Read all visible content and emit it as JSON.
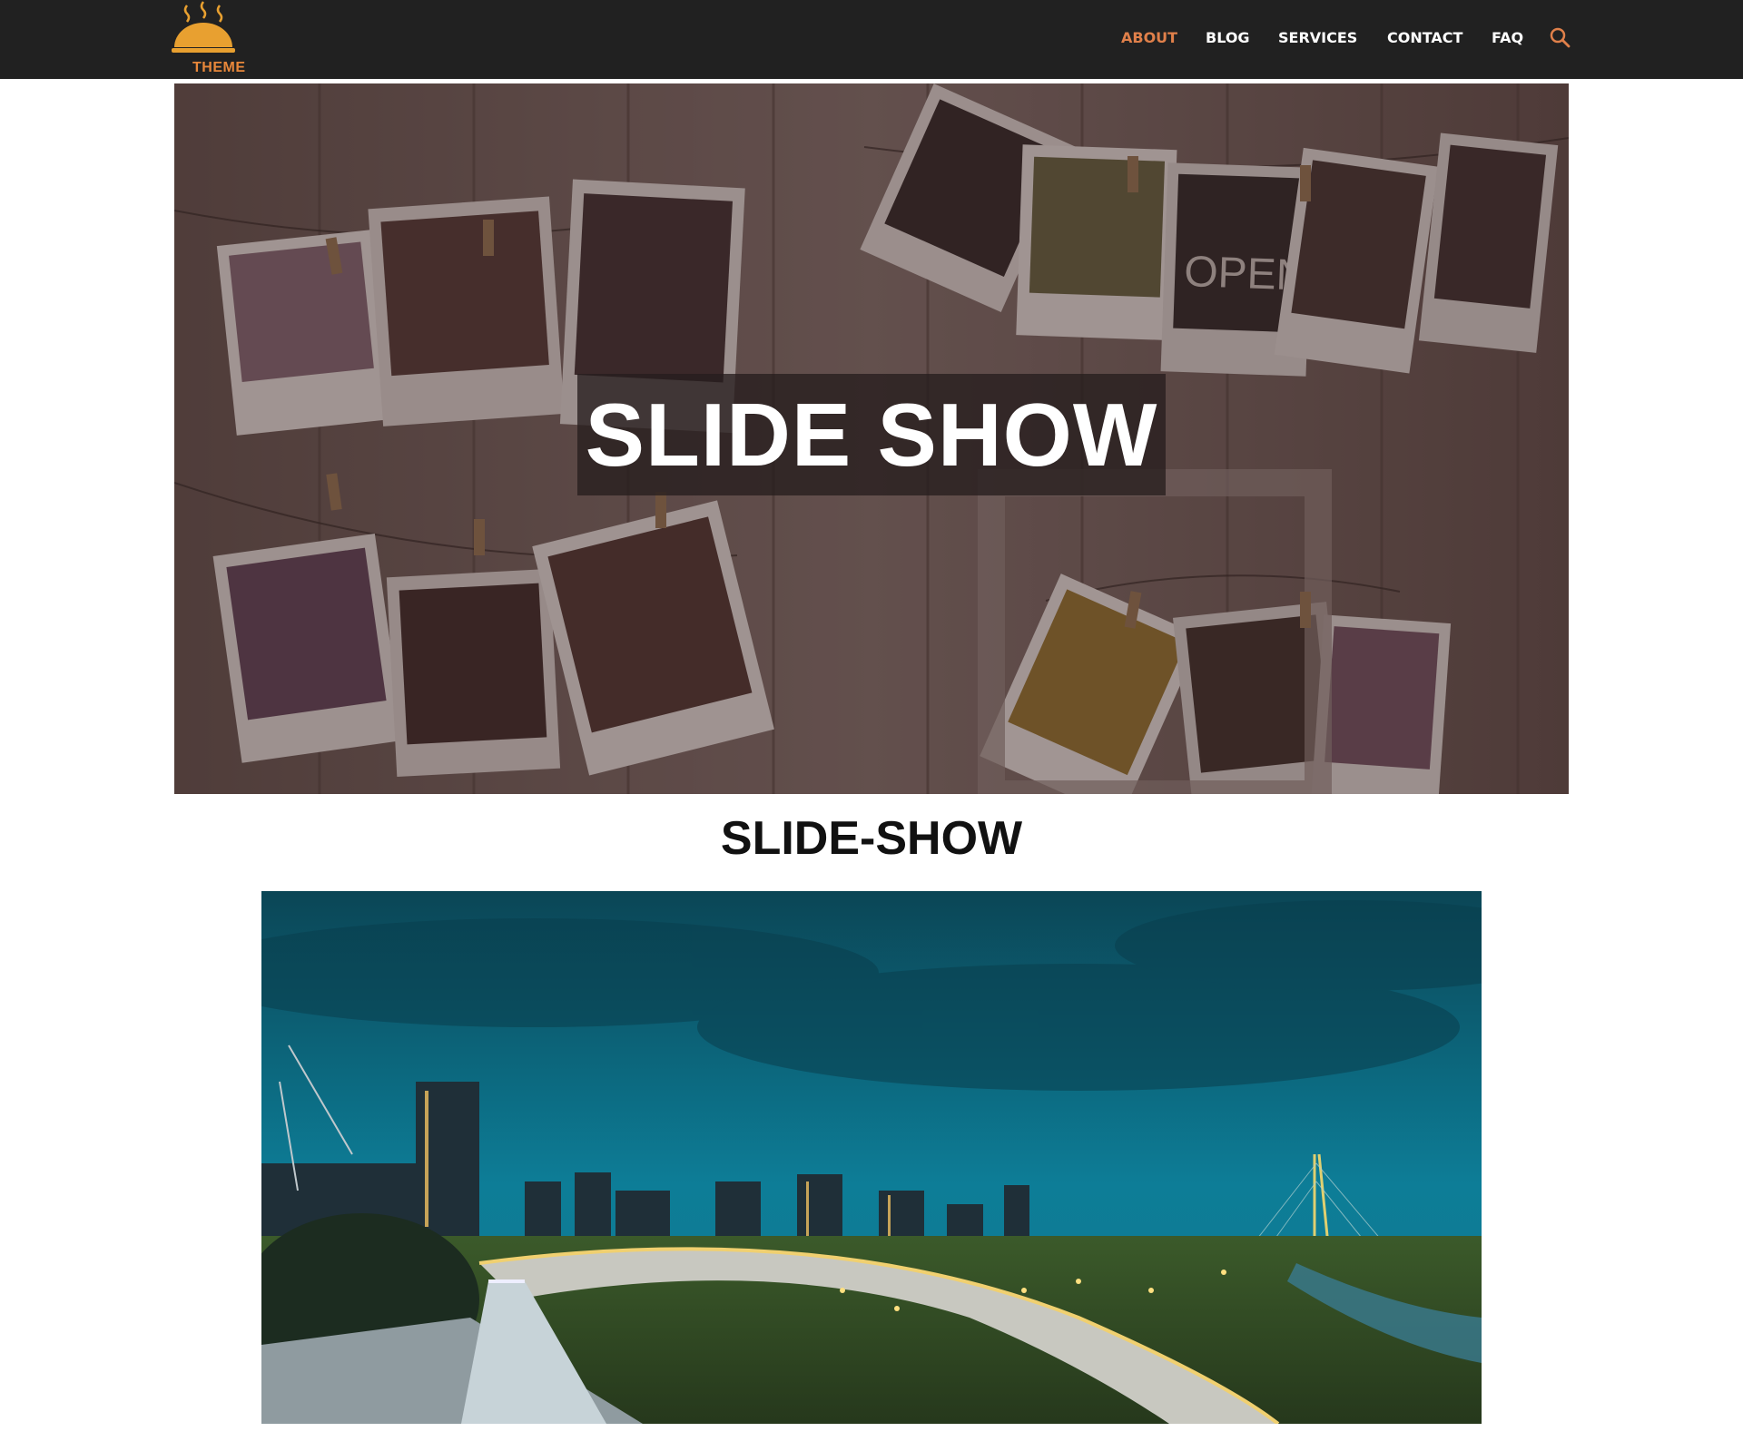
{
  "header": {
    "logo_text": "THEME",
    "brand_color": "#e8a030",
    "nav": [
      {
        "label": "ABOUT",
        "active": true
      },
      {
        "label": "BLOG",
        "active": false
      },
      {
        "label": "SERVICES",
        "active": false
      },
      {
        "label": "CONTACT",
        "active": false
      },
      {
        "label": "FAQ",
        "active": false
      }
    ],
    "active_color": "#e0804a",
    "search_icon": "search-icon"
  },
  "hero": {
    "title": "SLIDE SHOW",
    "image": "polaroid-photos-on-wooden-wall"
  },
  "section": {
    "heading": "SLIDE-SHOW",
    "image": "city-skyline-bridge-night"
  }
}
